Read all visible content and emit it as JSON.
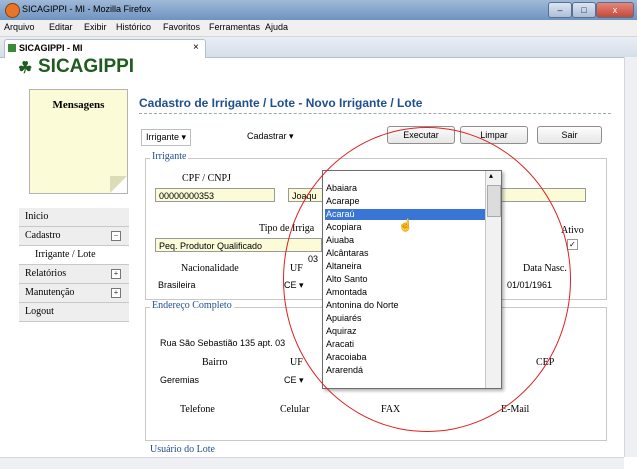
{
  "window": {
    "title": "SICAGIPPI - MI - Mozilla Firefox",
    "btn_min": "–",
    "btn_max": "□",
    "btn_close": "x"
  },
  "menu": [
    "Arquivo",
    "Editar",
    "Exibir",
    "Histórico",
    "Favoritos",
    "Ferramentas",
    "Ajuda"
  ],
  "tab": {
    "label": "SICAGIPPI - MI",
    "close": "×"
  },
  "logo": {
    "icon": "☘",
    "text": "SICAGIPPI"
  },
  "messages": {
    "title": "Mensagens"
  },
  "nav": {
    "inicio": "Inicio",
    "cadastro": "Cadastro",
    "cadastro_toggle": "−",
    "irrigante_lote": "Irrigante / Lote",
    "relatorios": "Relatórios",
    "relatorios_toggle": "+",
    "manutencao": "Manutenção",
    "manutencao_toggle": "+",
    "logout": "Logout"
  },
  "form": {
    "title": "Cadastro de Irrigante / Lote - Novo Irrigante / Lote",
    "menu_irrigante": "Irrigante",
    "menu_cadastrar": "Cadastrar",
    "caret": "▾",
    "btn_executar": "Executar",
    "btn_limpar": "Limpar",
    "btn_sair": "Sair"
  },
  "irrigante": {
    "legend": "Irrigante",
    "cpf_label": "CPF / CNPJ",
    "cpf_value": "00000000353",
    "name_value": "Joaqu",
    "tipo_label": "Tipo de Irriga",
    "tipo_value": "Peq. Produtor Qualificado",
    "ativo_label": "Ativo",
    "ativo_check": "✓",
    "nacionalidade_label": "Nacionalidade",
    "nacionalidade_value": "Brasileira",
    "uf_label": "UF",
    "uf_value": "CE",
    "cidade_partial": "03",
    "data_nasc_label": "Data Nasc.",
    "data_nasc_value": "01/01/1961"
  },
  "endereco": {
    "legend": "Endereço Completo",
    "rua_value": "Rua São Sebastião 135 apt. 03",
    "bairro_label": "Bairro",
    "bairro_value": "Geremias",
    "uf_label": "UF",
    "uf_value": "CE",
    "cep_label": "CEP",
    "telefone_label": "Telefone",
    "celular_label": "Celular",
    "fax_label": "FAX",
    "email_label": "E-Mail"
  },
  "usuario": {
    "legend": "Usuário do Lote"
  },
  "city_dropdown": {
    "options": [
      "Abaiara",
      "Acarape",
      "Acaraú",
      "Acopiara",
      "Aiuaba",
      "Alcântaras",
      "Altaneira",
      "Alto Santo",
      "Amontada",
      "Antonina do Norte",
      "Apuiarés",
      "Aquiraz",
      "Aracati",
      "Aracoiaba",
      "Ararendá"
    ],
    "selected": "Acaraú",
    "scroll_up": "▴",
    "scroll_down": "▾"
  },
  "colors": {
    "annotation": "#e02020",
    "selection": "#3875d7",
    "title_blue": "#1f4f8f",
    "logo_green": "#1e5d1e"
  }
}
